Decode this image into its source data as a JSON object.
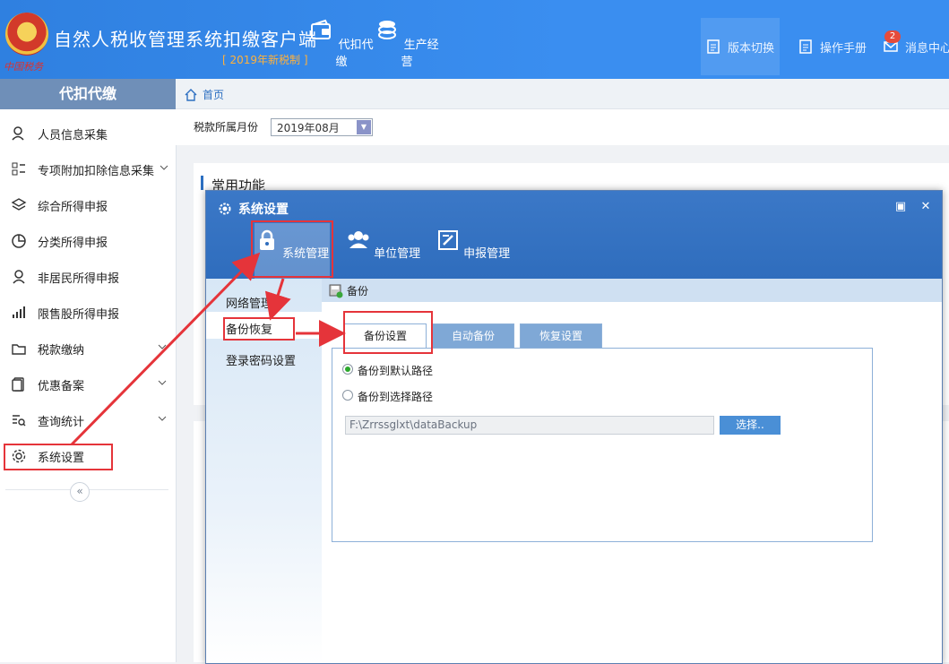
{
  "header": {
    "app_title": "自然人税收管理系统扣缴客户端",
    "subtitle": "[ 2019年新税制 ]",
    "brand_script": "中国税务",
    "nav": [
      {
        "label": "代扣代缴",
        "icon": "wallet-icon"
      },
      {
        "label": "生产经营",
        "icon": "coins-icon"
      }
    ],
    "right": {
      "version_label": "版本切换",
      "manual_label": "操作手册",
      "message_label": "消息中心",
      "message_count": "2"
    }
  },
  "sidebar": {
    "title": "代扣代缴",
    "items": [
      {
        "label": "人员信息采集",
        "icon": "person-icon"
      },
      {
        "label": "专项附加扣除信息采集",
        "icon": "grid-list-icon"
      },
      {
        "label": "综合所得申报",
        "icon": "layers-icon"
      },
      {
        "label": "分类所得申报",
        "icon": "pie-icon"
      },
      {
        "label": "非居民所得申报",
        "icon": "person-outline-icon"
      },
      {
        "label": "限售股所得申报",
        "icon": "bar-chart-icon"
      },
      {
        "label": "税款缴纳",
        "icon": "folder-icon"
      },
      {
        "label": "优惠备案",
        "icon": "document-icon"
      },
      {
        "label": "查询统计",
        "icon": "search-list-icon"
      },
      {
        "label": "系统设置",
        "icon": "gear-icon"
      }
    ],
    "collapse_symbol": "«"
  },
  "breadcrumb": {
    "home": "首页"
  },
  "filter": {
    "month_label": "税款所属月份",
    "month_value": "2019年08月"
  },
  "main": {
    "panel_title": "常用功能"
  },
  "modal": {
    "title": "系统设置",
    "tabs": [
      {
        "label": "系统管理",
        "icon": "lock-icon"
      },
      {
        "label": "单位管理",
        "icon": "users-icon"
      },
      {
        "label": "申报管理",
        "icon": "edit-icon"
      }
    ],
    "left_items": [
      "网络管理",
      "备份恢复",
      "登录密码设置"
    ],
    "section_title": "备份",
    "sub_tabs": [
      "备份设置",
      "自动备份",
      "恢复设置"
    ],
    "options": [
      "备份到默认路径",
      "备份到选择路径"
    ],
    "path_value": "F:\\Zrrssglxt\\dataBackup",
    "choose_button": "选择.."
  },
  "colors": {
    "header_blue": "#3a8ef0",
    "accent": "#2c6fc1",
    "highlight_red": "#e5343a",
    "subtitle_orange": "#ffb13b"
  }
}
